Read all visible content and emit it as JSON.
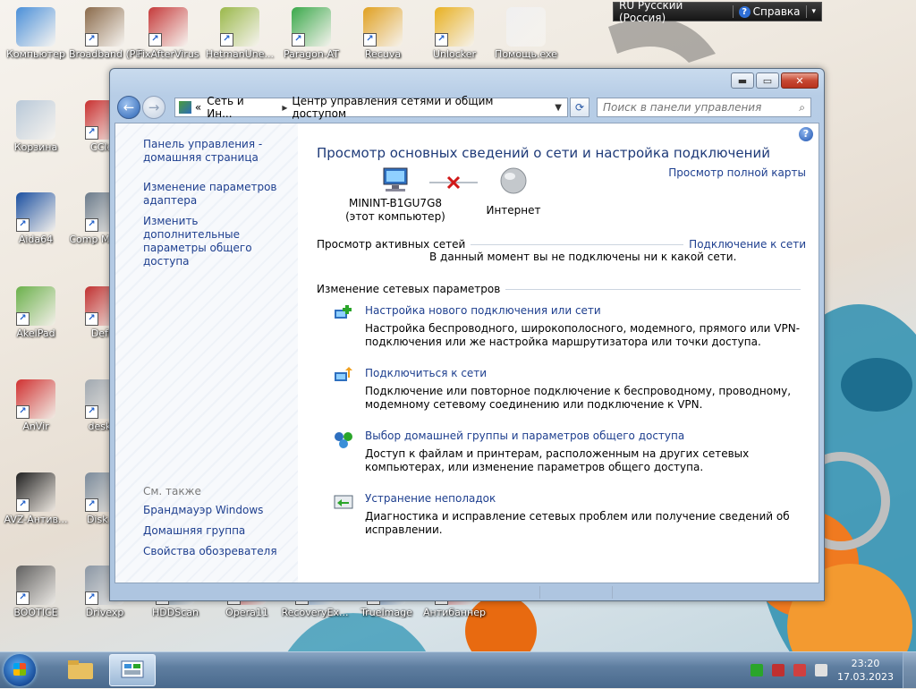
{
  "desktop_icons": [
    {
      "label": "Компьютер",
      "color": "#4a8fd8",
      "shortcut": false
    },
    {
      "label": "Broadband (PPPo",
      "color": "#8a6a4a",
      "shortcut": true
    },
    {
      "label": "FixAfterVirus",
      "color": "#c53a3a",
      "shortcut": true
    },
    {
      "label": "HetmanUne...",
      "color": "#9ab84a",
      "shortcut": true
    },
    {
      "label": "Paragon-AT",
      "color": "#3aa84a",
      "shortcut": true
    },
    {
      "label": "Recuva",
      "color": "#e0a020",
      "shortcut": true
    },
    {
      "label": "Unlocker",
      "color": "#e8b020",
      "shortcut": true
    },
    {
      "label": "Помощь.exe",
      "color": "#f0f0f0",
      "shortcut": false
    },
    {
      "label": "Корзина",
      "color": "#b8c8d8",
      "shortcut": false
    },
    {
      "label": "CClea",
      "color": "#c83030",
      "shortcut": true
    },
    {
      "label": "Aida64",
      "color": "#1a4fa0",
      "shortcut": true
    },
    {
      "label": "Comp Manage",
      "color": "#6a7a8a",
      "shortcut": true
    },
    {
      "label": "AkelPad",
      "color": "#6ab04a",
      "shortcut": true
    },
    {
      "label": "Defra",
      "color": "#c03030",
      "shortcut": true
    },
    {
      "label": "AnVir",
      "color": "#d03030",
      "shortcut": true
    },
    {
      "label": "deskto",
      "color": "#a0a8b0",
      "shortcut": true
    },
    {
      "label": "AVZ-Антив...",
      "color": "#202020",
      "shortcut": true
    },
    {
      "label": "Disk Dr",
      "color": "#7a8a9a",
      "shortcut": true
    },
    {
      "label": "BOOTICE",
      "color": "#606060",
      "shortcut": true
    },
    {
      "label": "Drivexp",
      "color": "#8a96a4",
      "shortcut": true
    },
    {
      "label": "HDDScan",
      "color": "#4a6a8a",
      "shortcut": true
    },
    {
      "label": "Opera11",
      "color": "#c02020",
      "shortcut": true
    },
    {
      "label": "RecoveryEx...",
      "color": "#4a80c0",
      "shortcut": true
    },
    {
      "label": "TrueImage",
      "color": "#3060a0",
      "shortcut": true
    },
    {
      "label": "Антибаннер",
      "color": "#d04040",
      "shortcut": true
    }
  ],
  "langbar": {
    "language": "RU Русский (Россия)",
    "help": "Справка"
  },
  "window": {
    "breadcrumb_root": "«",
    "breadcrumb_1": "Сеть и Ин...",
    "breadcrumb_2": "Центр управления сетями и общим доступом",
    "search_placeholder": "Поиск в панели управления",
    "sidebar": {
      "home": "Панель управления - домашняя страница",
      "adapter": "Изменение параметров адаптера",
      "sharing": "Изменить дополнительные параметры общего доступа",
      "see_also": "См. также",
      "see_also_links": [
        "Брандмауэр Windows",
        "Домашняя группа",
        "Свойства обозревателя"
      ]
    },
    "title": "Просмотр основных сведений о сети и настройка подключений",
    "full_map": "Просмотр полной карты",
    "computer_name": "MININT-B1GU7G8",
    "computer_sub": "(этот компьютер)",
    "internet": "Интернет",
    "active_networks": "Просмотр активных сетей",
    "connect_link": "Подключение к сети",
    "not_connected": "В данный момент вы не подключены ни к какой сети.",
    "change_settings": "Изменение сетевых параметров",
    "tasks": [
      {
        "title": "Настройка нового подключения или сети",
        "desc": "Настройка беспроводного, широкополосного, модемного, прямого или VPN-подключения или же настройка маршрутизатора или точки доступа."
      },
      {
        "title": "Подключиться к сети",
        "desc": "Подключение или повторное подключение к беспроводному, проводному, модемному сетевому соединению или подключение к VPN."
      },
      {
        "title": "Выбор домашней группы и параметров общего доступа",
        "desc": "Доступ к файлам и принтерам, расположенным на других сетевых компьютерах, или изменение параметров общего доступа."
      },
      {
        "title": "Устранение неполадок",
        "desc": "Диагностика и исправление сетевых проблем или получение сведений об исправлении."
      }
    ]
  },
  "taskbar": {
    "time": "23:20",
    "date": "17.03.2023"
  }
}
